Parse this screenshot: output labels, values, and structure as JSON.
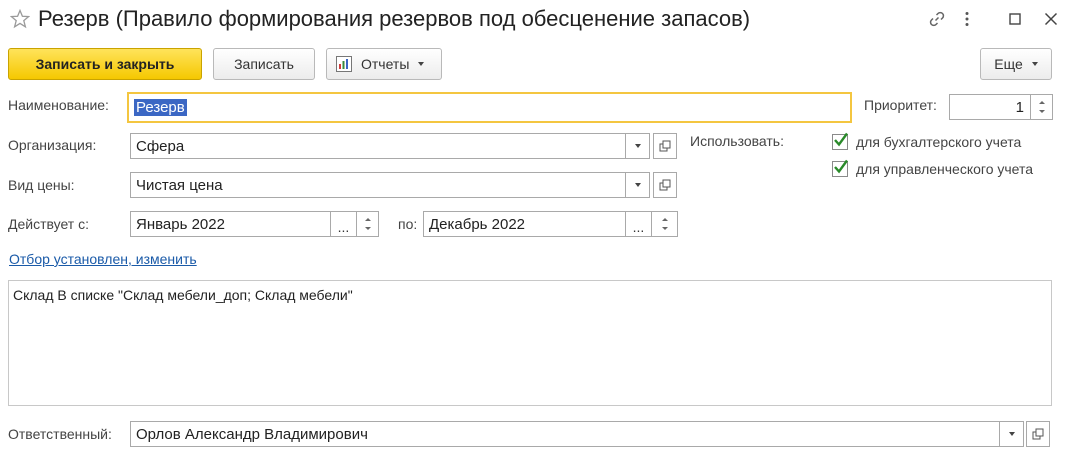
{
  "window": {
    "title": "Резерв (Правило формирования резервов под обесценение запасов)"
  },
  "toolbar": {
    "save_close_label": "Записать и закрыть",
    "save_label": "Записать",
    "reports_label": "Отчеты",
    "more_label": "Еще"
  },
  "form": {
    "name": {
      "label": "Наименование:",
      "value": "Резерв"
    },
    "priority": {
      "label": "Приоритет:",
      "value": "1"
    },
    "organization": {
      "label": "Организация:",
      "value": "Сфера"
    },
    "price_type": {
      "label": "Вид цены:",
      "value": "Чистая цена"
    },
    "valid_from": {
      "label": "Действует с:",
      "value": "Январь 2022"
    },
    "valid_to": {
      "label": "по:",
      "value": "Декабрь 2022"
    },
    "use": {
      "label": "Использовать:",
      "accounting": {
        "label": "для бухгалтерского учета",
        "checked": true
      },
      "management": {
        "label": "для управленческого учета",
        "checked": true
      }
    },
    "filter_link": "Отбор установлен, изменить",
    "filter_text": "Склад В списке \"Склад мебели_доп; Склад мебели\"",
    "responsible": {
      "label": "Ответственный:",
      "value": "Орлов Александр Владимирович"
    }
  },
  "colors": {
    "accent_yellow": "#f5c800",
    "focus_border": "#f4c640",
    "link_blue": "#1a5aa8",
    "check_green": "#2a8a2a",
    "selection_blue": "#3b67c4"
  }
}
